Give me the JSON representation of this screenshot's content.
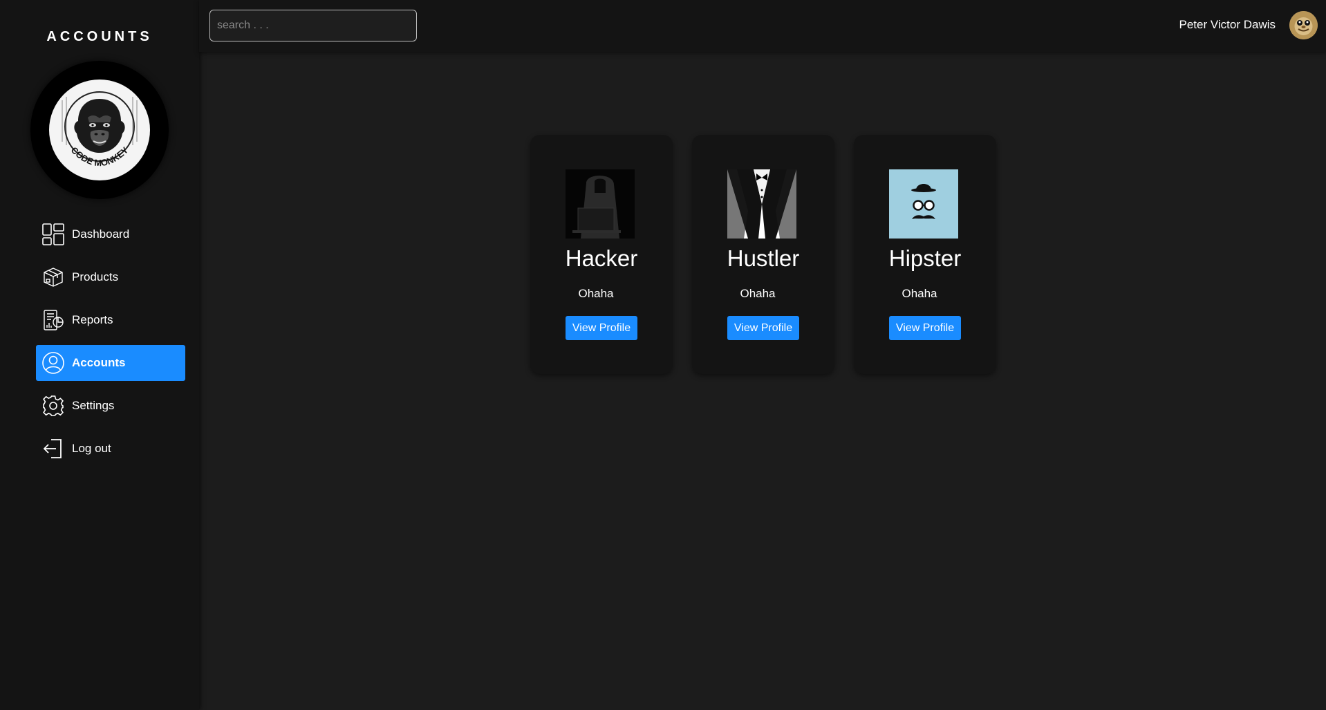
{
  "sidebar": {
    "brand": "ACCOUNTS",
    "logo_text": "CODE MONKEY",
    "items": [
      {
        "label": "Dashboard",
        "icon": "dashboard-icon"
      },
      {
        "label": "Products",
        "icon": "box-icon"
      },
      {
        "label": "Reports",
        "icon": "report-icon"
      },
      {
        "label": "Accounts",
        "icon": "user-circle-icon",
        "active": true
      },
      {
        "label": "Settings",
        "icon": "gear-icon"
      },
      {
        "label": "Log out",
        "icon": "logout-icon"
      }
    ]
  },
  "header": {
    "search_placeholder": "search . . .",
    "search_value": "",
    "user_name": "Peter Victor Dawis"
  },
  "cards": [
    {
      "title": "Hacker",
      "subtitle": "Ohaha",
      "button": "View Profile"
    },
    {
      "title": "Hustler",
      "subtitle": "Ohaha",
      "button": "View Profile"
    },
    {
      "title": "Hipster",
      "subtitle": "Ohaha",
      "button": "View Profile"
    }
  ],
  "colors": {
    "accent": "#1a8cff",
    "background": "#1c1c1c",
    "panel": "#141414"
  }
}
